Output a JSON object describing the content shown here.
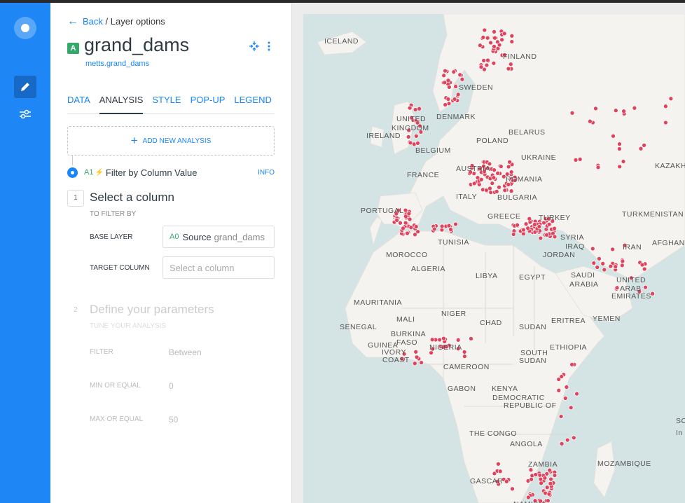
{
  "nav": {
    "logo_icon": "carto-logo-icon",
    "items": [
      {
        "icon": "pencil-icon",
        "active": true
      },
      {
        "icon": "sliders-icon",
        "active": false
      }
    ]
  },
  "header": {
    "back_label": "Back",
    "breadcrumb_sep": " / ",
    "breadcrumb_current": "Layer options",
    "layer_letter": "A",
    "layer_title": "grand_dams",
    "layer_source": "metts.grand_dams"
  },
  "tabs": [
    "DATA",
    "ANALYSIS",
    "STYLE",
    "POP-UP",
    "LEGEND"
  ],
  "active_tab": "ANALYSIS",
  "add_analysis_label": "ADD NEW ANALYSIS",
  "analysis": {
    "id": "A1",
    "name": "Filter by Column Value",
    "info_label": "INFO"
  },
  "step1": {
    "number": "1",
    "title": "Select a column",
    "subtitle": "TO FILTER BY",
    "base_layer_label": "BASE LAYER",
    "base_layer_id": "A0",
    "base_layer_prefix": "Source",
    "base_layer_value": "grand_dams",
    "target_column_label": "TARGET COLUMN",
    "target_column_placeholder": "Select a column"
  },
  "step2": {
    "number": "2",
    "title": "Define your parameters",
    "subtitle": "TUNE YOUR ANALYSIS",
    "filter_label": "FILTER",
    "filter_value": "Between",
    "min_label": "MIN OR EQUAL",
    "min_value": "0",
    "max_label": "MAX OR EQUAL",
    "max_value": "50"
  },
  "map": {
    "labels": [
      "ICELAND",
      "FINLAND",
      "SWEDEN",
      "DENMARK",
      "UNITED",
      "KINGDOM",
      "IRELAND",
      "BELARUS",
      "POLAND",
      "BELGIUM",
      "UKRAINE",
      "KAZAKH",
      "FRANCE",
      "AUSTRIA",
      "ROMANIA",
      "ITALY",
      "BULGARIA",
      "PORTUGAL",
      "TURKMENISTAN",
      "GREECE",
      "TURKEY",
      "TUNISIA",
      "SYRIA",
      "IRAQ",
      "IRAN",
      "AFGHAN",
      "MOROCCO",
      "JORDAN",
      "ALGERIA",
      "LIBYA",
      "EGYPT",
      "SAUDI",
      "ARABIA",
      "UNITED",
      "ARAB",
      "EMIRATES",
      "MAURITANIA",
      "MALI",
      "NIGER",
      "CHAD",
      "ERITREA",
      "YEMEN",
      "SENEGAL",
      "SUDAN",
      "BURKINA",
      "FASO",
      "GUINEA",
      "IVORY",
      "COAST",
      "NIGERIA",
      "ETHIOPIA",
      "SOUTH",
      "SUDAN",
      "CAMEROON",
      "GABON",
      "KENYA",
      "DEMOCRATIC",
      "REPUBLIC OF",
      "THE CONGO",
      "ANGOLA",
      "ZAMBIA",
      "MOZAMBIQUE",
      "GASCAR",
      "NAMIBIA",
      "SOUTH",
      "In",
      "O"
    ],
    "dot_color": "#e0435c",
    "water_color": "#d4e4e4",
    "land_color": "#f5f3f0"
  },
  "colors": {
    "accent": "#1785fb",
    "nav_bg": "#1f86f5",
    "analysis_green": "#35a86b"
  }
}
